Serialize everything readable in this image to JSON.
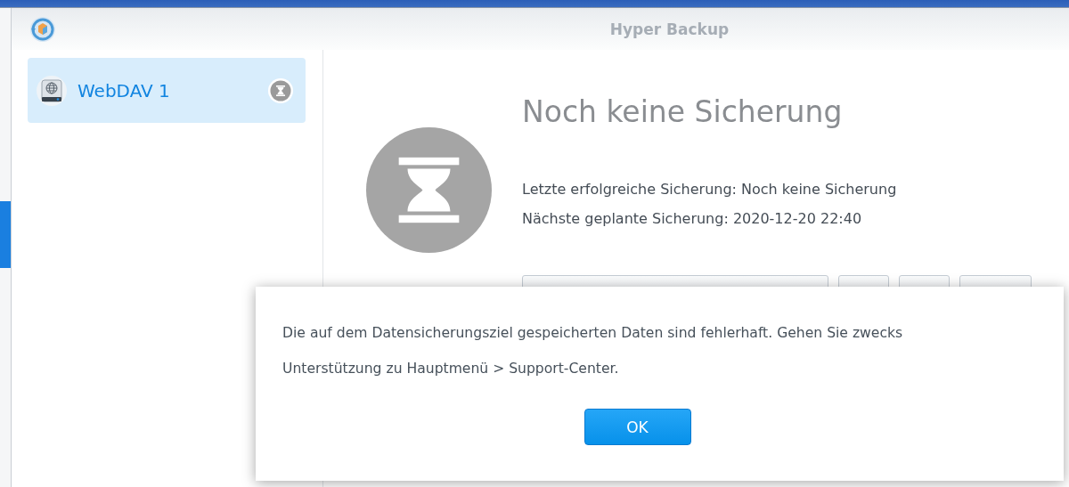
{
  "window": {
    "title": "Hyper Backup"
  },
  "sidebar": {
    "items": [
      {
        "label": "WebDAV 1",
        "selected": true
      }
    ]
  },
  "status": {
    "title": "Noch keine Sicherung",
    "lines": [
      "Letzte erfolgreiche Sicherung: Noch keine Sicherung",
      "Nächste geplante Sicherung: 2020-12-20 22:40"
    ]
  },
  "dialog": {
    "message": "Die auf dem Datensicherungsziel gespeicherten Daten sind fehlerhaft. Gehen Sie zwecks Unterstützung zu Hauptmenü > Support-Center.",
    "button": "OK"
  }
}
